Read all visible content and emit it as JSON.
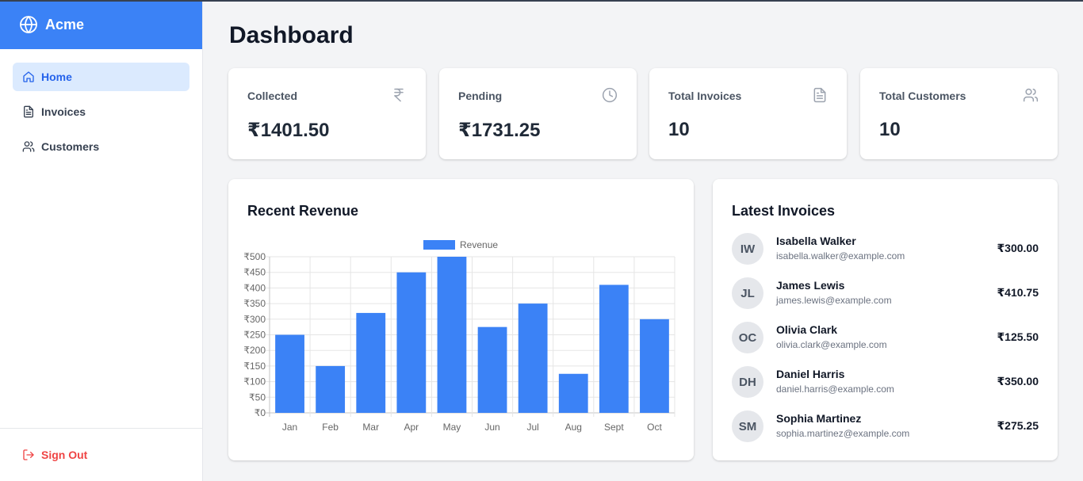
{
  "app": {
    "name": "Acme"
  },
  "sidebar": {
    "items": [
      {
        "label": "Home",
        "icon": "home-icon",
        "active": true
      },
      {
        "label": "Invoices",
        "icon": "document-icon",
        "active": false
      },
      {
        "label": "Customers",
        "icon": "users-icon",
        "active": false
      }
    ],
    "signout_label": "Sign Out"
  },
  "page": {
    "title": "Dashboard"
  },
  "stats": [
    {
      "label": "Collected",
      "value": "₹1401.50",
      "icon": "rupee-icon"
    },
    {
      "label": "Pending",
      "value": "₹1731.25",
      "icon": "clock-icon"
    },
    {
      "label": "Total Invoices",
      "value": "10",
      "icon": "document-icon"
    },
    {
      "label": "Total Customers",
      "value": "10",
      "icon": "users-icon"
    }
  ],
  "revenue": {
    "title": "Recent Revenue"
  },
  "chart_data": {
    "type": "bar",
    "title": "",
    "legend": {
      "position": "top",
      "entries": [
        "Revenue"
      ]
    },
    "categories": [
      "Jan",
      "Feb",
      "Mar",
      "Apr",
      "May",
      "Jun",
      "Jul",
      "Aug",
      "Sept",
      "Oct"
    ],
    "series": [
      {
        "name": "Revenue",
        "values": [
          250,
          150,
          320,
          450,
          500,
          275,
          350,
          125,
          410,
          300
        ],
        "color": "#3b82f6"
      }
    ],
    "ylim": [
      0,
      500
    ],
    "yticks": [
      0,
      50,
      100,
      150,
      200,
      250,
      300,
      350,
      400,
      450,
      500
    ],
    "ytick_prefix": "₹",
    "grid": true
  },
  "latest_invoices": {
    "title": "Latest Invoices",
    "items": [
      {
        "initials": "IW",
        "name": "Isabella Walker",
        "email": "isabella.walker@example.com",
        "amount": "₹300.00"
      },
      {
        "initials": "JL",
        "name": "James Lewis",
        "email": "james.lewis@example.com",
        "amount": "₹410.75"
      },
      {
        "initials": "OC",
        "name": "Olivia Clark",
        "email": "olivia.clark@example.com",
        "amount": "₹125.50"
      },
      {
        "initials": "DH",
        "name": "Daniel Harris",
        "email": "daniel.harris@example.com",
        "amount": "₹350.00"
      },
      {
        "initials": "SM",
        "name": "Sophia Martinez",
        "email": "sophia.martinez@example.com",
        "amount": "₹275.25"
      }
    ]
  },
  "colors": {
    "brand": "#3b82f6",
    "active_bg": "#dbeafe",
    "danger": "#ef4444"
  }
}
